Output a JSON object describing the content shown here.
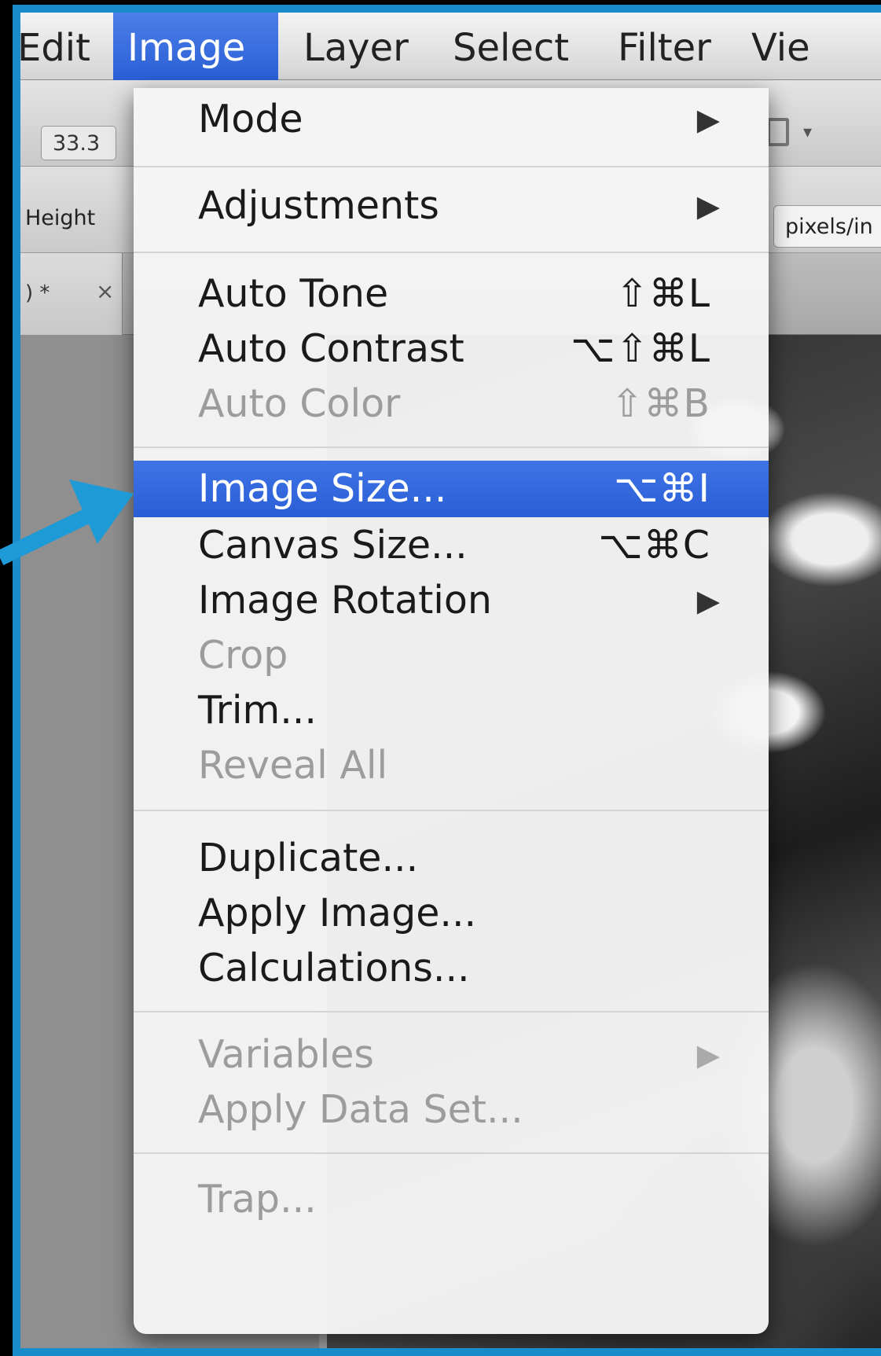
{
  "menubar": {
    "items": [
      "Edit",
      "Image",
      "Layer",
      "Select",
      "Filter",
      "Vie"
    ],
    "active": "Image"
  },
  "options_bar": {
    "zoom": "33.3",
    "height_label": "Height",
    "resolution_units": "pixels/in"
  },
  "document_tab": {
    "label": ") *",
    "close": "×"
  },
  "image_menu": {
    "mode": {
      "label": "Mode",
      "submenu": "▶"
    },
    "adjustments": {
      "label": "Adjustments",
      "submenu": "▶"
    },
    "auto_tone": {
      "label": "Auto Tone",
      "shortcut": "⇧⌘L"
    },
    "auto_contrast": {
      "label": "Auto Contrast",
      "shortcut": "⌥⇧⌘L"
    },
    "auto_color": {
      "label": "Auto Color",
      "shortcut": "⇧⌘B"
    },
    "image_size": {
      "label": "Image Size...",
      "shortcut": "⌥⌘I"
    },
    "canvas_size": {
      "label": "Canvas Size...",
      "shortcut": "⌥⌘C"
    },
    "image_rotation": {
      "label": "Image Rotation",
      "submenu": "▶"
    },
    "crop": {
      "label": "Crop"
    },
    "trim": {
      "label": "Trim..."
    },
    "reveal_all": {
      "label": "Reveal All"
    },
    "duplicate": {
      "label": "Duplicate..."
    },
    "apply_image": {
      "label": "Apply Image..."
    },
    "calculations": {
      "label": "Calculations..."
    },
    "variables": {
      "label": "Variables",
      "submenu": "▶"
    },
    "apply_data_set": {
      "label": "Apply Data Set..."
    },
    "trap": {
      "label": "Trap..."
    }
  },
  "colors": {
    "frame_blue": "#1a8cc9",
    "highlight_blue": "#2f66dc",
    "arrow_blue": "#1e9ad6"
  }
}
